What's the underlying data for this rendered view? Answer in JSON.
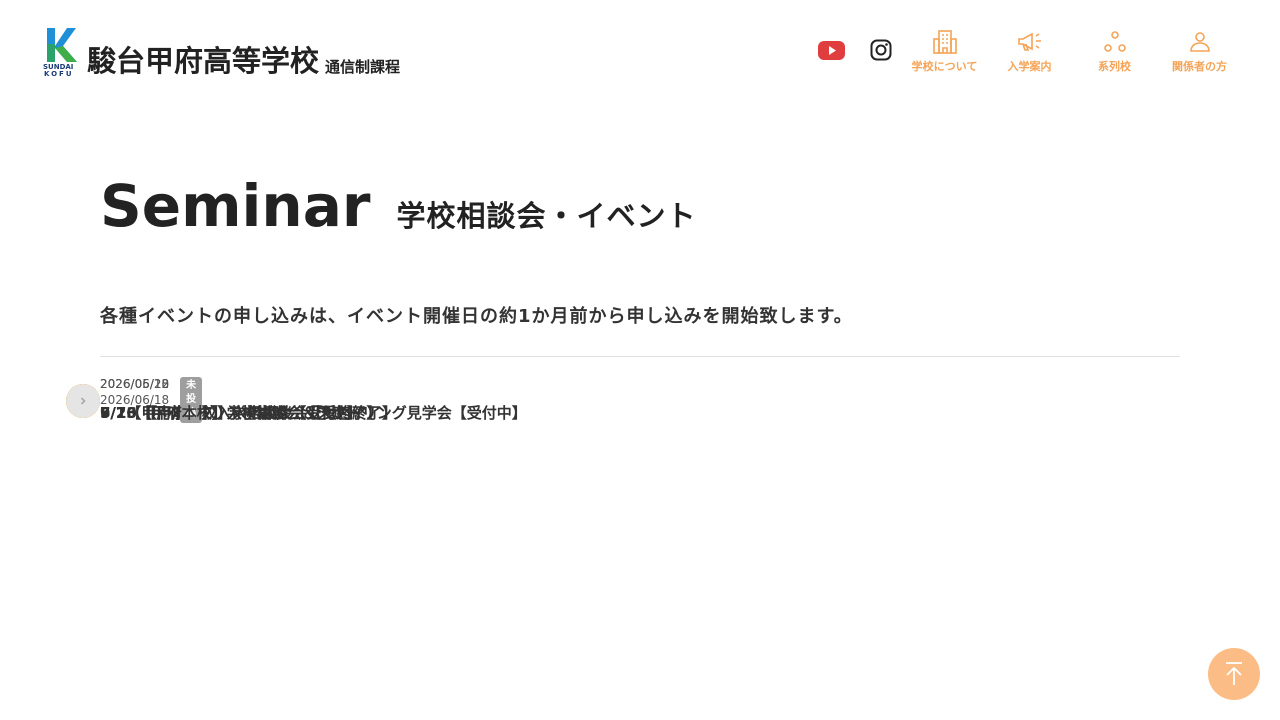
{
  "header": {
    "school_name": "駿台甲府高等学校",
    "course_name": "通信制課程",
    "logo_small_text": "SUNDAI KOFU",
    "sns": [
      {
        "name": "youtube-icon",
        "color": "#e03e3e"
      },
      {
        "name": "instagram-icon",
        "color": "#222222"
      }
    ],
    "nav": [
      {
        "label": "学校について",
        "icon": "building-icon"
      },
      {
        "label": "入学案内",
        "icon": "megaphone-icon"
      },
      {
        "label": "系列校",
        "icon": "network-icon"
      },
      {
        "label": "関係者の方",
        "icon": "person-icon"
      }
    ],
    "accent_color": "#f5a457"
  },
  "main": {
    "title_en": "Seminar",
    "title_ja": "学校相談会・イベント",
    "lead": "各種イベントの申し込みは、イベント開催日の約1か月前から申し込みを開始致します。",
    "events": [
      {
        "date": "2026/05/12",
        "badge": "",
        "title": "5/16 【甲府本校】入学相談会【受付終了】",
        "active": true
      },
      {
        "date": "2026/05/20",
        "badge": "",
        "title": "6/7【甲府本校】入学相談会【受付終了】",
        "active": true
      },
      {
        "date": "2026/06/18",
        "badge": "",
        "title": "7/20【甲府本校】学校説明会＆スクーリング見学会【受付中】",
        "active": true
      },
      {
        "date": "2026/06/18",
        "badge": "未投稿",
        "title": "9/13【甲府本校】入学相談会【予定】",
        "active": false
      }
    ]
  },
  "colors": {
    "arrow_active": "#f7a21b",
    "arrow_disabled": "#e5e5e5",
    "to_top": "#fbbd85"
  }
}
